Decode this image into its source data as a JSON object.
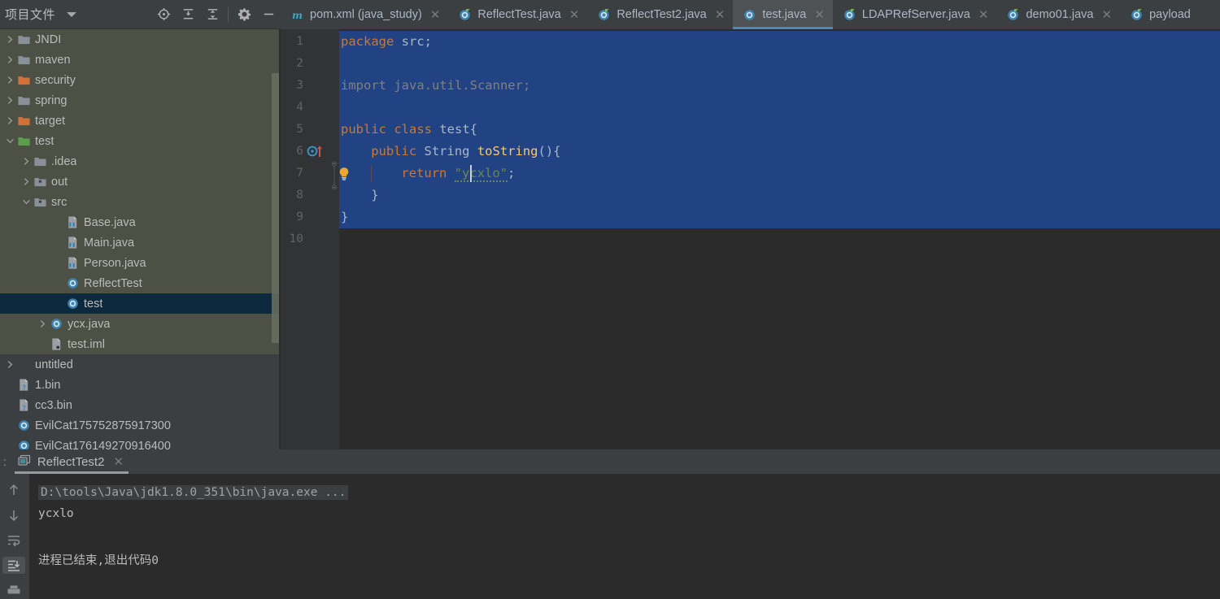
{
  "project_panel": {
    "title": "项目文件",
    "dropdown_icon": "chevron-down-icon",
    "toolbar_icons": [
      "locate-target-icon",
      "expand-all-icon",
      "collapse-all-icon",
      "gear-icon",
      "minimize-icon"
    ],
    "tree": [
      {
        "label": "JNDI",
        "icon": "folder-gray-icon",
        "arrow": "right",
        "indent": 0,
        "state": "tint"
      },
      {
        "label": "maven",
        "icon": "folder-gray-icon",
        "arrow": "right",
        "indent": 0,
        "state": "tint"
      },
      {
        "label": "security",
        "icon": "folder-orange-icon",
        "arrow": "right",
        "indent": 0,
        "state": "tint"
      },
      {
        "label": "spring",
        "icon": "folder-gray-icon",
        "arrow": "right",
        "indent": 0,
        "state": "tint"
      },
      {
        "label": "target",
        "icon": "folder-orange-icon",
        "arrow": "right",
        "indent": 0,
        "state": "tint"
      },
      {
        "label": "test",
        "icon": "folder-green-icon",
        "arrow": "down",
        "indent": 0,
        "state": "tint"
      },
      {
        "label": ".idea",
        "icon": "folder-gray-icon",
        "arrow": "right",
        "indent": 1,
        "state": "tint"
      },
      {
        "label": "out",
        "icon": "folder-src-icon",
        "arrow": "right",
        "indent": 1,
        "state": "tint"
      },
      {
        "label": "src",
        "icon": "folder-src-icon",
        "arrow": "down",
        "indent": 1,
        "state": "tint"
      },
      {
        "label": "Base.java",
        "icon": "java-file-icon",
        "arrow": "none",
        "indent": 3,
        "state": "tint"
      },
      {
        "label": "Main.java",
        "icon": "java-file-icon",
        "arrow": "none",
        "indent": 3,
        "state": "tint"
      },
      {
        "label": "Person.java",
        "icon": "java-file-icon",
        "arrow": "none",
        "indent": 3,
        "state": "tint"
      },
      {
        "label": "ReflectTest",
        "icon": "java-class-icon",
        "arrow": "none",
        "indent": 3,
        "state": "tint"
      },
      {
        "label": "test",
        "icon": "java-class-icon",
        "arrow": "none",
        "indent": 3,
        "state": "selected"
      },
      {
        "label": "ycx.java",
        "icon": "java-class-icon",
        "arrow": "right",
        "indent": 2,
        "state": "tint"
      },
      {
        "label": "test.iml",
        "icon": "iml-file-icon",
        "arrow": "none",
        "indent": 2,
        "state": "tint"
      },
      {
        "label": "untitled",
        "icon": "none",
        "arrow": "right",
        "indent": 0,
        "state": "normal"
      },
      {
        "label": "1.bin",
        "icon": "unknown-file-icon",
        "arrow": "none",
        "indent": 0,
        "state": "normal"
      },
      {
        "label": "cc3.bin",
        "icon": "unknown-file-icon",
        "arrow": "none",
        "indent": 0,
        "state": "normal"
      },
      {
        "label": "EvilCat175752875917300",
        "icon": "class-file-icon",
        "arrow": "none",
        "indent": 0,
        "state": "normal"
      },
      {
        "label": "EvilCat176149270916400",
        "icon": "class-file-icon",
        "arrow": "none",
        "indent": 0,
        "state": "normal"
      }
    ]
  },
  "editor_tabs": [
    {
      "label": "pom.xml (java_study)",
      "icon": "maven-m-icon",
      "active": false,
      "closable": true
    },
    {
      "label": "ReflectTest.java",
      "icon": "java-run-icon",
      "active": false,
      "closable": true
    },
    {
      "label": "ReflectTest2.java",
      "icon": "java-run-icon",
      "active": false,
      "closable": true
    },
    {
      "label": "test.java",
      "icon": "java-class-icon",
      "active": true,
      "closable": true
    },
    {
      "label": "LDAPRefServer.java",
      "icon": "java-run-icon",
      "active": false,
      "closable": true
    },
    {
      "label": "demo01.java",
      "icon": "java-run-icon",
      "active": false,
      "closable": true
    },
    {
      "label": "payload",
      "icon": "java-run-icon",
      "active": false,
      "closable": false
    }
  ],
  "editor": {
    "line_numbers": [
      "1",
      "2",
      "3",
      "4",
      "5",
      "6",
      "7",
      "8",
      "9",
      "10"
    ],
    "lines": [
      {
        "n": 1,
        "indent": 0,
        "tokens": [
          {
            "t": "package ",
            "c": "k"
          },
          {
            "t": "src;",
            "c": "id"
          }
        ]
      },
      {
        "n": 2,
        "indent": 0,
        "tokens": []
      },
      {
        "n": 3,
        "indent": 0,
        "tokens": [
          {
            "t": "import java.util.Scanner;",
            "c": "cm"
          }
        ]
      },
      {
        "n": 4,
        "indent": 0,
        "tokens": []
      },
      {
        "n": 5,
        "indent": 0,
        "tokens": [
          {
            "t": "public class ",
            "c": "k"
          },
          {
            "t": "test{",
            "c": "id"
          }
        ]
      },
      {
        "n": 6,
        "indent": 1,
        "tokens": [
          {
            "t": "public ",
            "c": "k"
          },
          {
            "t": "String ",
            "c": "id"
          },
          {
            "t": "toString",
            "c": "mth"
          },
          {
            "t": "(){",
            "c": "id"
          }
        ]
      },
      {
        "n": 7,
        "indent": 2,
        "tokens": [
          {
            "t": "return ",
            "c": "k"
          },
          {
            "t": "\"ycxlo\"",
            "c": "str"
          },
          {
            "t": ";",
            "c": "id"
          }
        ]
      },
      {
        "n": 8,
        "indent": 1,
        "tokens": [
          {
            "t": "}",
            "c": "id"
          }
        ]
      },
      {
        "n": 9,
        "indent": 0,
        "tokens": [
          {
            "t": "}",
            "c": "id"
          }
        ]
      },
      {
        "n": 10,
        "indent": 0,
        "tokens": []
      }
    ],
    "selection_color": "#214283",
    "selected_lines": [
      1,
      2,
      3,
      4,
      5,
      6,
      7,
      8,
      9
    ],
    "gutter_markers": [
      {
        "line": 6,
        "icon": "override-method-icon"
      },
      {
        "line": 7,
        "icon": "intention-bulb-icon"
      }
    ],
    "caret_line": 7,
    "caret_column_label": "ycxlo",
    "spellcheck_word": "ycxlo"
  },
  "run_panel": {
    "tab_label": "ReflectTest2",
    "tab_icon": "console-icon",
    "tab_close_icon": "close-icon",
    "prefix": ":",
    "gutter_icons": [
      "arrow-up-icon",
      "arrow-down-icon",
      "soft-wrap-icon",
      "scroll-to-end-icon",
      "print-icon"
    ],
    "console_lines": [
      {
        "text": "D:\\tools\\Java\\jdk1.8.0_351\\bin\\java.exe ...",
        "style": "command"
      },
      {
        "text": "ycxlo",
        "style": "output"
      },
      {
        "text": "",
        "style": "output"
      },
      {
        "text": "进程已结束,退出代码0",
        "style": "output"
      }
    ]
  },
  "colors": {
    "bg_panel": "#3c3f41",
    "bg_editor": "#2b2b2b",
    "accent_blue": "#4a88c7",
    "selection": "#214283",
    "keyword_orange": "#cc7832",
    "string_green": "#6a8759",
    "method_yellow": "#ffc66d",
    "tree_tint_green": "#4d5145",
    "tree_selected": "#0d293e"
  }
}
